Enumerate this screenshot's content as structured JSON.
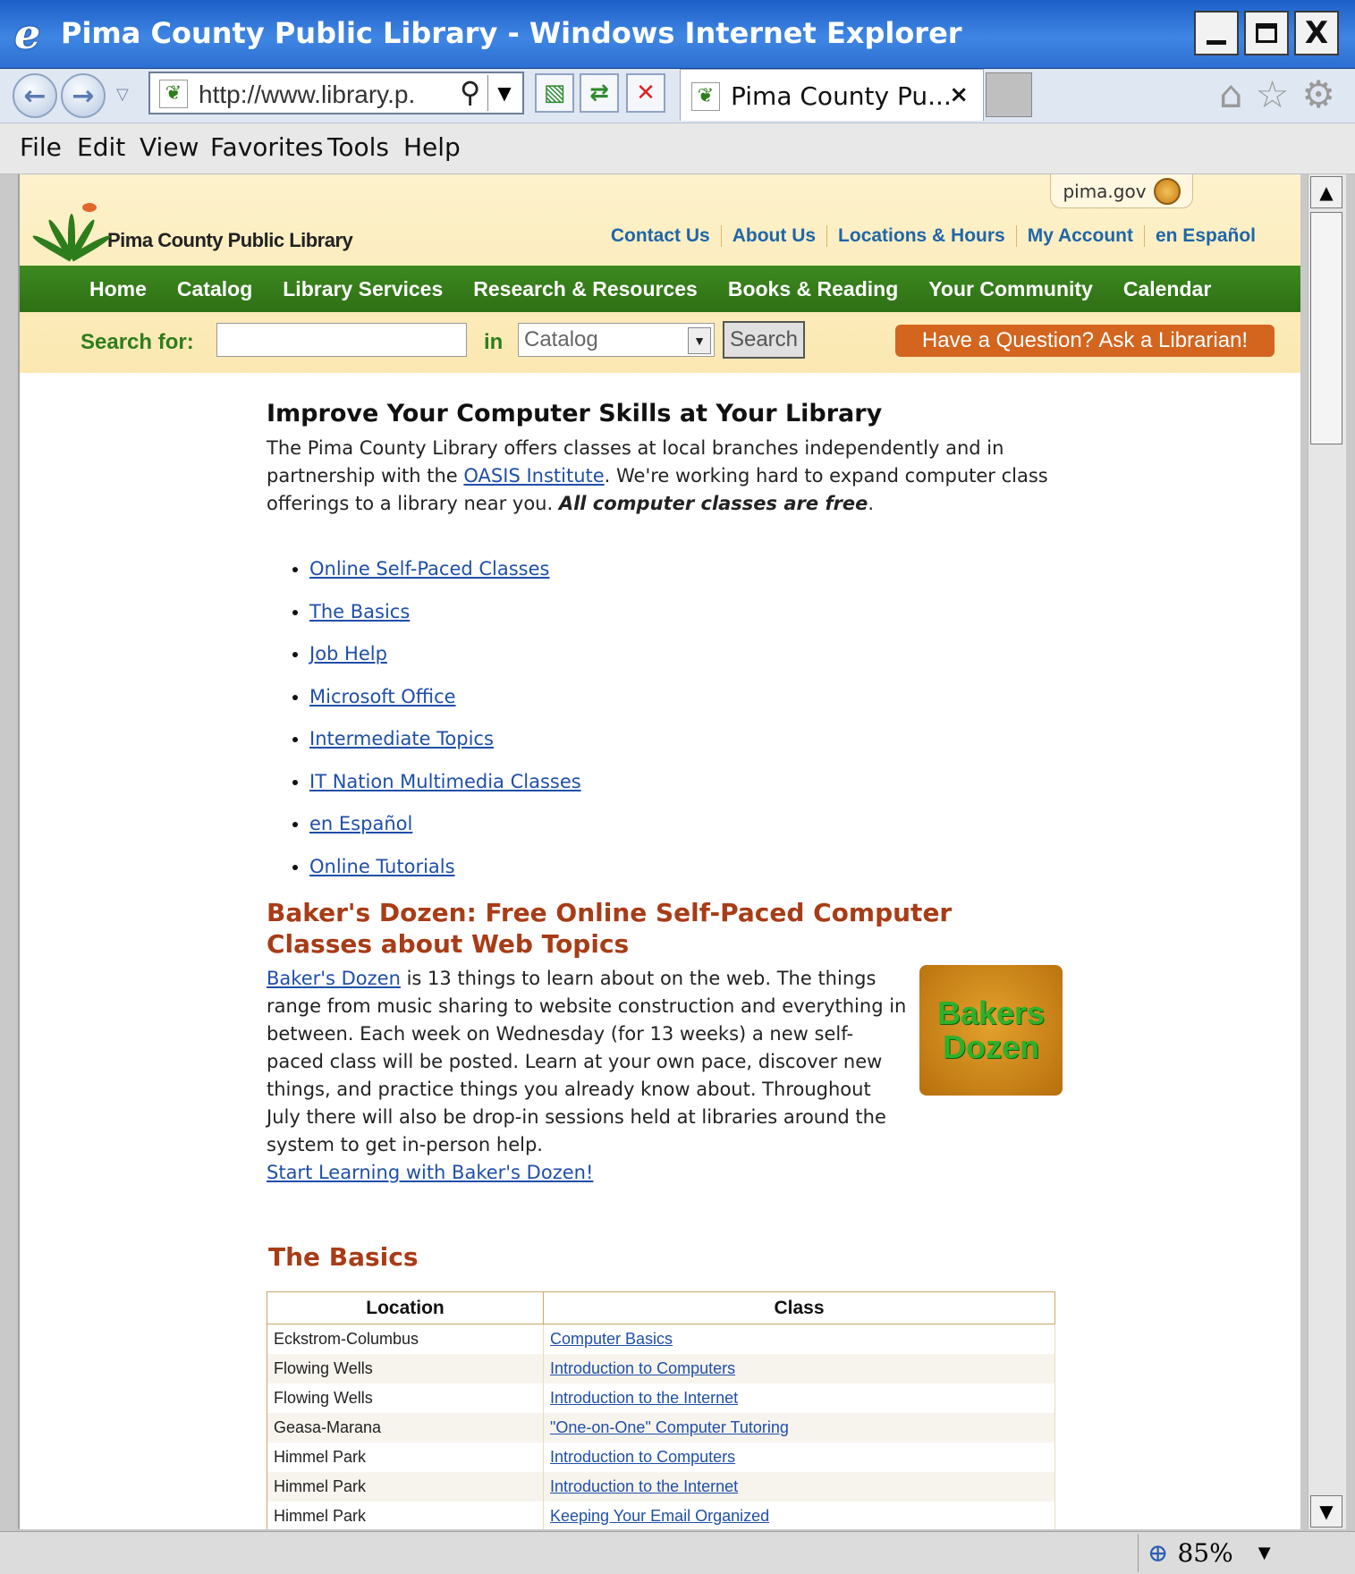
{
  "window": {
    "title": "Pima County Public Library - Windows Internet Explorer",
    "buttons": {
      "minimize": "_",
      "maximize": "□",
      "close": "X"
    }
  },
  "browser": {
    "url": "http://www.library.p.",
    "tab_title": "Pima County Pu...",
    "tab_close": "×",
    "menu": [
      "File",
      "Edit",
      "View",
      "Favorites",
      "Tools",
      "Help"
    ],
    "zoom": "85%"
  },
  "header": {
    "pima_gov": "pima.gov",
    "logo_text": "Pima County Public Library",
    "top_links": [
      "Contact Us",
      "About Us",
      "Locations & Hours",
      "My Account",
      "en Español"
    ],
    "nav": [
      "Home",
      "Catalog",
      "Library Services",
      "Research & Resources",
      "Books & Reading",
      "Your Community",
      "Calendar"
    ],
    "search": {
      "label": "Search for:",
      "in_label": "in",
      "scope_value": "Catalog",
      "button": "Search",
      "ask": "Have a Question? Ask a Librarian!"
    }
  },
  "main": {
    "heading": "Improve Your Computer Skills at Your Library",
    "intro_part1": "The Pima County Library offers classes at local branches independently and in partnership with the ",
    "intro_link": "OASIS Institute",
    "intro_part2": ". We're working hard to expand computer class offerings to a library near you. ",
    "intro_bold": "All computer classes are free",
    "intro_end": ".",
    "topics": [
      "Online Self-Paced Classes",
      "The Basics",
      "Job Help",
      "Microsoft Office",
      "Intermediate Topics",
      "IT Nation Multimedia Classes",
      "en Español",
      "Online Tutorials"
    ],
    "bakers": {
      "title": "Baker's Dozen: Free Online Self-Paced Computer Classes about Web Topics",
      "link": "Baker's Dozen",
      "body": " is 13 things to learn about on the web. The things range from music sharing to website construction and everything in between. Each week on Wednesday (for 13 weeks) a new self-paced class will be posted. Learn at your own pace, discover new things, and practice things you already know about. Throughout July there will also be drop-in sessions held at libraries around the system to get in-person help.",
      "cta": "Start Learning with Baker's Dozen!",
      "logo_line1": "Bakers",
      "logo_line2": "Dozen"
    },
    "basics": {
      "title": "The Basics",
      "columns": [
        "Location",
        "Class"
      ],
      "rows": [
        {
          "location": "Eckstrom-Columbus",
          "class": "Computer Basics"
        },
        {
          "location": "Flowing Wells",
          "class": "Introduction to Computers"
        },
        {
          "location": "Flowing Wells",
          "class": "Introduction to the Internet"
        },
        {
          "location": "Geasa-Marana",
          "class": "\"One-on-One\" Computer Tutoring"
        },
        {
          "location": "Himmel Park",
          "class": "Introduction to Computers"
        },
        {
          "location": "Himmel Park",
          "class": "Introduction to the Internet"
        },
        {
          "location": "Himmel Park",
          "class": "Keeping Your Email Organized"
        }
      ]
    }
  }
}
